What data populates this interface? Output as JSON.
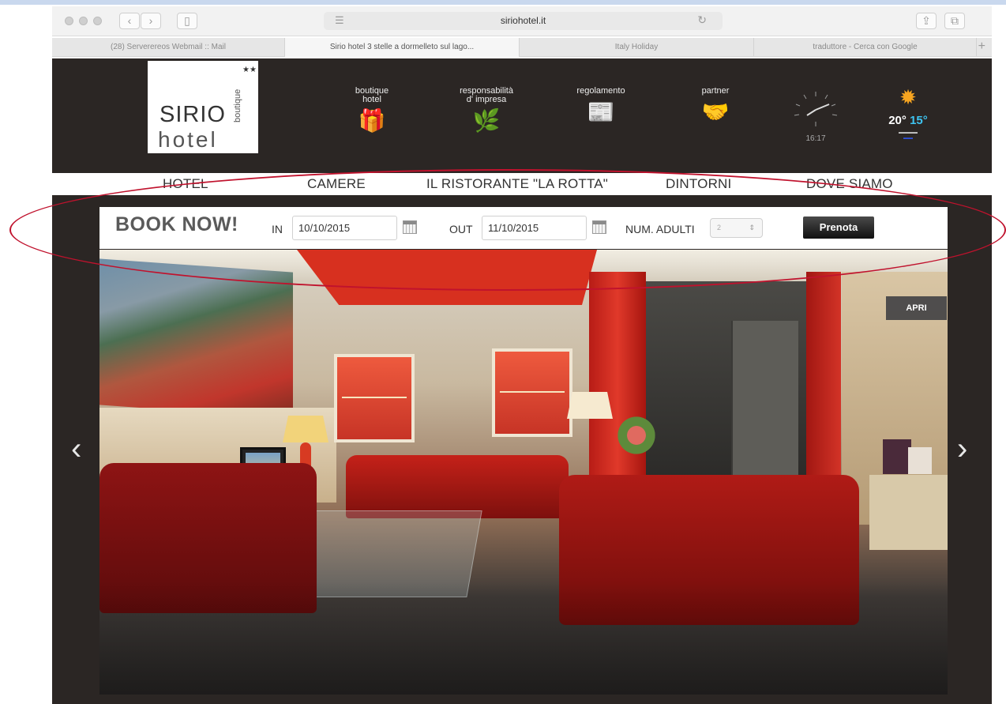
{
  "browser": {
    "url": "siriohotel.it",
    "tabs": [
      {
        "label": "(28) Serverereos Webmail :: Mail",
        "active": false
      },
      {
        "label": "Sirio hotel 3 stelle a dormelleto sul lago...",
        "active": true
      },
      {
        "label": "Italy Holiday",
        "active": false
      },
      {
        "label": "traduttore - Cerca con Google",
        "active": false
      }
    ]
  },
  "header": {
    "logo": {
      "line1": "SIRIO",
      "line2": "hotel",
      "vertical": "boutique",
      "stars": "★★"
    },
    "items": [
      {
        "label1": "boutique",
        "label2": "hotel",
        "icon": "gift-icon",
        "glyph": "🎁"
      },
      {
        "label1": "responsabilità",
        "label2": "d' impresa",
        "icon": "tree-icon",
        "glyph": "🌿"
      },
      {
        "label1": "regolamento",
        "label2": "",
        "icon": "document-icon",
        "glyph": "📰"
      },
      {
        "label1": "partner",
        "label2": "",
        "icon": "handshake-icon",
        "glyph": "🤝"
      }
    ],
    "clock": {
      "time": "16:17"
    },
    "weather": {
      "icon": "sun-icon",
      "glyph": "✹",
      "max": "20°",
      "min": "15°"
    }
  },
  "menu": [
    "HOTEL",
    "CAMERE",
    "IL RISTORANTE \"LA ROTTA\"",
    "DINTORNI",
    "DOVE SIAMO"
  ],
  "booking": {
    "title": "BOOK NOW!",
    "in_label": "IN",
    "in_value": "10/10/2015",
    "out_label": "OUT",
    "out_value": "11/10/2015",
    "adults_label": "NUM. ADULTI",
    "adults_value": "2",
    "submit": "Prenota"
  },
  "slider": {
    "apri": "APRI",
    "prev": "‹",
    "next": "›"
  },
  "colors": {
    "header_bg": "#2b2624",
    "annotation_ellipse": "#c0122d",
    "temp_min": "#3ec3f0"
  }
}
